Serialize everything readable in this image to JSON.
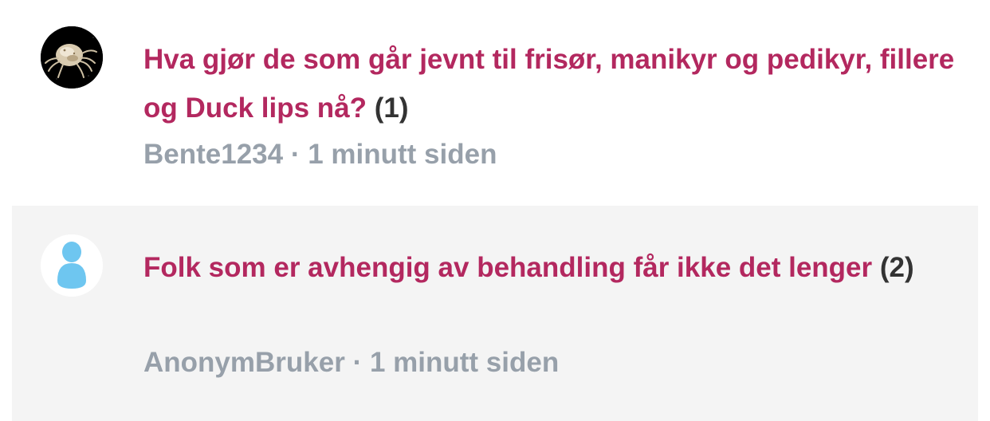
{
  "topics": [
    {
      "title": "Hva gjør de som går jevnt til frisør, manikyr og pedikyr, fillere og Duck lips nå?",
      "reply_count": "(1)",
      "author": "Bente1234",
      "separator": "·",
      "time": "1 minutt siden",
      "avatar_icon": "crab-photo-avatar"
    },
    {
      "title": "Folk som er avhengig av behandling får ikke det lenger",
      "reply_count": "(2)",
      "author": "AnonymBruker",
      "separator": "·",
      "time": "1 minutt siden",
      "avatar_icon": "person-silhouette-icon"
    }
  ],
  "colors": {
    "title": "#b3285f",
    "count": "#333333",
    "meta": "#97a0aa",
    "alt_row_bg": "#f4f4f4",
    "anon_avatar": "#6ec6f0"
  }
}
